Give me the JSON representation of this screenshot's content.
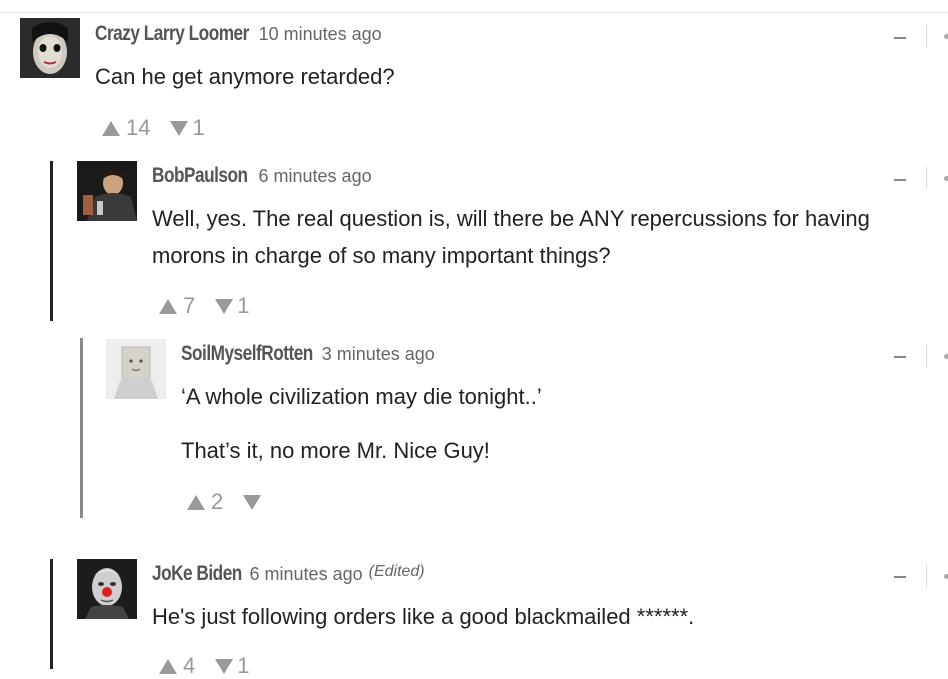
{
  "comments": [
    {
      "username": "Crazy Larry Loomer",
      "time": "10 minutes ago",
      "text": [
        "Can he get anymore retarded?"
      ],
      "upvotes": "14",
      "downvotes": "1"
    },
    {
      "username": "BobPaulson",
      "time": "6 minutes ago",
      "text": [
        "Well, yes. The real question is, will there be ANY repercussions for having morons in charge of so many important things?"
      ],
      "upvotes": "7",
      "downvotes": "1"
    },
    {
      "username": "SoilMyselfRotten",
      "time": "3 minutes ago",
      "text": [
        "‘A whole civilization may die tonight..’",
        "That’s it, no more Mr. Nice Guy!"
      ],
      "upvotes": "2",
      "downvotes": ""
    },
    {
      "username": "JoKe Biden",
      "time": "6 minutes ago",
      "edited": "(Edited)",
      "text": [
        "He's just following orders like a good blackmailed ******."
      ],
      "upvotes": "4",
      "downvotes": "1"
    }
  ],
  "icons": {
    "upvote": "triangle-up-icon",
    "downvote": "triangle-down-icon",
    "collapse": "minus-icon",
    "menu": "more-dot-icon"
  },
  "colors": {
    "thread_bar_dark": "#222222",
    "thread_bar_gray": "#888888",
    "text": "#222222",
    "meta": "#666666",
    "vote": "#999999"
  }
}
